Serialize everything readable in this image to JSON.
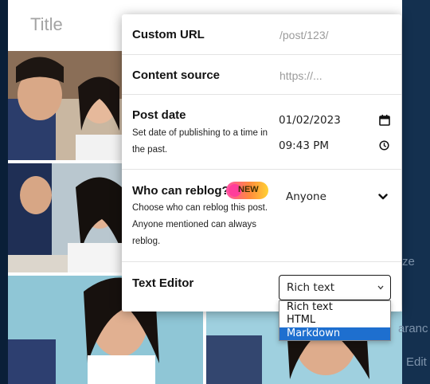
{
  "editor": {
    "title_placeholder": "Title",
    "side_hints": [
      "ze",
      "aranc",
      "Edit"
    ]
  },
  "panel": {
    "custom_url": {
      "label": "Custom URL",
      "placeholder": "/post/123/"
    },
    "content_source": {
      "label": "Content source",
      "placeholder": "https://..."
    },
    "post_date": {
      "label": "Post date",
      "description": "Set date of publishing to a time in the past.",
      "date": "01/02/2023",
      "time": "09:43 PM"
    },
    "reblog": {
      "label": "Who can reblog?",
      "badge": "NEW",
      "description": "Choose who can reblog this post. Anyone mentioned can always reblog.",
      "value": "Anyone"
    },
    "text_editor": {
      "label": "Text Editor",
      "value": "Rich text",
      "options": [
        "Rich text",
        "HTML",
        "Markdown"
      ],
      "highlighted_option": "Markdown"
    }
  },
  "colors": {
    "accent_blue": "#1e6fcf",
    "badge_gradient": [
      "#ff4fa6",
      "#ff8a3d",
      "#ffd233"
    ],
    "background": "#0c2340"
  }
}
